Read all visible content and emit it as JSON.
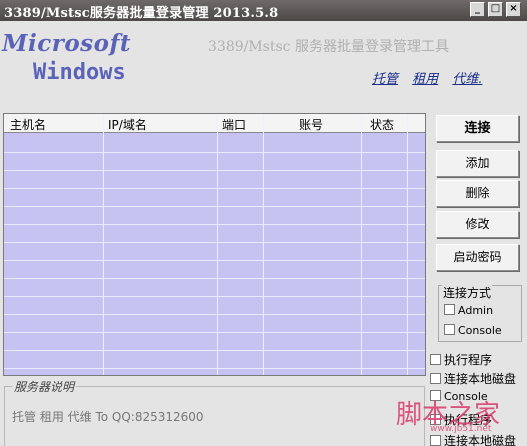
{
  "window": {
    "title": "3389/Mstsc服务器批量登录管理   2013.5.8",
    "buttons": {
      "minimize": "_",
      "maximize": "□",
      "close": "×"
    }
  },
  "header": {
    "logo_line1": "Microsoft",
    "logo_line2": "Windows",
    "subtitle": "3389/Mstsc 服务器批量登录管理工具",
    "links": [
      "托管",
      "租用",
      "代维."
    ]
  },
  "table": {
    "columns": [
      "主机名",
      "IP/域名",
      "端口",
      "账号",
      "状态"
    ],
    "rows": []
  },
  "actions": {
    "connect": "连接",
    "add": "添加",
    "delete": "删除",
    "edit": "修改",
    "start_password": "启动密码"
  },
  "connection_mode": {
    "title": "连接方式",
    "options": [
      {
        "label": "Admin",
        "checked": false
      },
      {
        "label": "Console",
        "checked": false
      }
    ]
  },
  "options": [
    {
      "label": "执行程序",
      "checked": false
    },
    {
      "label": "连接本地磁盘",
      "checked": false
    },
    {
      "label": "Console",
      "checked": false
    },
    {
      "label": "执行程序",
      "checked": false
    },
    {
      "label": "连接本地磁盘",
      "checked": false
    }
  ],
  "server_description": {
    "title": "服务器说明",
    "text": "托管  租用  代维 To QQ:825312600"
  },
  "watermark": {
    "text": "脚本之家",
    "sub": "www.jb51.net"
  },
  "colors": {
    "grid_bg": "#c6c3f2",
    "logo": "#5a63b8",
    "title_bar": "#555050"
  }
}
